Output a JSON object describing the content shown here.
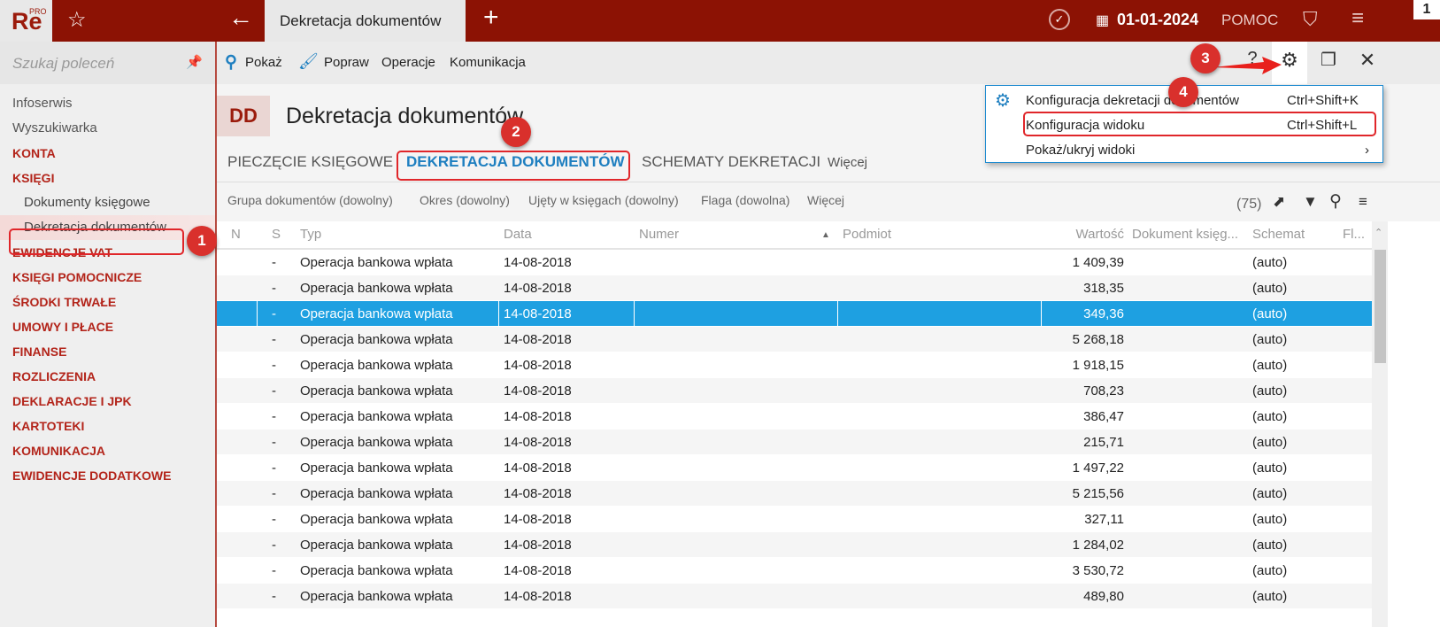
{
  "topbar": {
    "logo": "Re",
    "logo_sup": "PRO",
    "tab": "Dekretacja dokumentów",
    "date": "01-01-2024",
    "help": "POMOC",
    "corner_badge": "1"
  },
  "sidebar": {
    "search_placeholder": "Szukaj poleceń",
    "items": [
      {
        "label": "Infoserwis",
        "type": "g"
      },
      {
        "label": "Wyszukiwarka",
        "type": "g"
      },
      {
        "label": "KONTA",
        "type": "r"
      },
      {
        "label": "KSIĘGI",
        "type": "r"
      },
      {
        "label": "Dokumenty księgowe",
        "type": "sub"
      },
      {
        "label": "Dekretacja dokumentów",
        "type": "sub act"
      },
      {
        "label": "EWIDENCJE VAT",
        "type": "r"
      },
      {
        "label": "KSIĘGI POMOCNICZE",
        "type": "r"
      },
      {
        "label": "ŚRODKI TRWAŁE",
        "type": "r"
      },
      {
        "label": "UMOWY I PŁACE",
        "type": "r"
      },
      {
        "label": "FINANSE",
        "type": "r"
      },
      {
        "label": "ROZLICZENIA",
        "type": "r"
      },
      {
        "label": "DEKLARACJE I JPK",
        "type": "r"
      },
      {
        "label": "KARTOTEKI",
        "type": "r"
      },
      {
        "label": "KOMUNIKACJA",
        "type": "r"
      },
      {
        "label": "EWIDENCJE DODATKOWE",
        "type": "r"
      }
    ]
  },
  "toolbar": {
    "show": "Pokaż",
    "edit": "Popraw",
    "operations": "Operacje",
    "communication": "Komunikacja",
    "help": "?"
  },
  "header": {
    "badge": "DD",
    "title": "Dekretacja dokumentów"
  },
  "tabs": [
    "PIECZĘCIE KSIĘGOWE",
    "DEKRETACJA DOKUMENTÓW",
    "SCHEMATY DEKRETACJI",
    "Więcej"
  ],
  "filters": [
    "Grupa dokumentów (dowolny)",
    "Okres (dowolny)",
    "Ujęty w księgach (dowolny)",
    "Flaga (dowolna)",
    "Więcej"
  ],
  "count": "(75)",
  "columns": [
    "N",
    "S",
    "Typ",
    "Data",
    "Numer",
    "Podmiot",
    "Wartość",
    "Dokument księg...",
    "Schemat",
    "Fl..."
  ],
  "rows": [
    [
      "-",
      "Operacja bankowa wpłata",
      "14-08-2018",
      "1 409,39",
      "(auto)"
    ],
    [
      "-",
      "Operacja bankowa wpłata",
      "14-08-2018",
      "318,35",
      "(auto)"
    ],
    [
      "-",
      "Operacja bankowa wpłata",
      "14-08-2018",
      "349,36",
      "(auto)"
    ],
    [
      "-",
      "Operacja bankowa wpłata",
      "14-08-2018",
      "5 268,18",
      "(auto)"
    ],
    [
      "-",
      "Operacja bankowa wpłata",
      "14-08-2018",
      "1 918,15",
      "(auto)"
    ],
    [
      "-",
      "Operacja bankowa wpłata",
      "14-08-2018",
      "708,23",
      "(auto)"
    ],
    [
      "-",
      "Operacja bankowa wpłata",
      "14-08-2018",
      "386,47",
      "(auto)"
    ],
    [
      "-",
      "Operacja bankowa wpłata",
      "14-08-2018",
      "215,71",
      "(auto)"
    ],
    [
      "-",
      "Operacja bankowa wpłata",
      "14-08-2018",
      "1 497,22",
      "(auto)"
    ],
    [
      "-",
      "Operacja bankowa wpłata",
      "14-08-2018",
      "5 215,56",
      "(auto)"
    ],
    [
      "-",
      "Operacja bankowa wpłata",
      "14-08-2018",
      "327,11",
      "(auto)"
    ],
    [
      "-",
      "Operacja bankowa wpłata",
      "14-08-2018",
      "1 284,02",
      "(auto)"
    ],
    [
      "-",
      "Operacja bankowa wpłata",
      "14-08-2018",
      "3 530,72",
      "(auto)"
    ],
    [
      "-",
      "Operacja bankowa wpłata",
      "14-08-2018",
      "489,80",
      "(auto)"
    ]
  ],
  "selected_row": 2,
  "menu": [
    {
      "label": "Konfiguracja dekretacji dokumentów",
      "shortcut": "Ctrl+Shift+K"
    },
    {
      "label": "Konfiguracja widoku",
      "shortcut": "Ctrl+Shift+L"
    },
    {
      "label": "Pokaż/ukryj widoki",
      "shortcut": "›"
    }
  ],
  "callouts": [
    "1",
    "2",
    "3",
    "4"
  ],
  "colors": {
    "brand": "#8c1204",
    "accent": "#1ea0e1",
    "callout": "#d9302c"
  }
}
